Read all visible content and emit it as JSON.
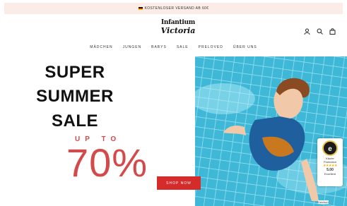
{
  "promo": {
    "text": "KOSTENLOSER VERSAND AB 60€"
  },
  "logo": {
    "line1": "Infantium",
    "line2": "Victoria"
  },
  "icons": [
    "account-icon",
    "search-icon",
    "cart-icon"
  ],
  "nav": {
    "items": [
      "MÄDCHEN",
      "JUNGEN",
      "BABYS",
      "SALE",
      "PRELOVED",
      "ÜBER UNS"
    ]
  },
  "hero": {
    "line1": "SUPER",
    "line2": "SUMMER",
    "line3": "SALE",
    "upto": "UP TO",
    "percent": "70%",
    "button": "SHOP NOW"
  },
  "badge": {
    "line1": "Käufer",
    "line2": "Protection",
    "score": "5.00",
    "label": "Exzellent"
  },
  "language": "Deutsch",
  "colors": {
    "accent": "#d44a4a",
    "button": "#d62b2b",
    "promo_bg": "#fbece7",
    "pool": "#3ab6d6"
  }
}
